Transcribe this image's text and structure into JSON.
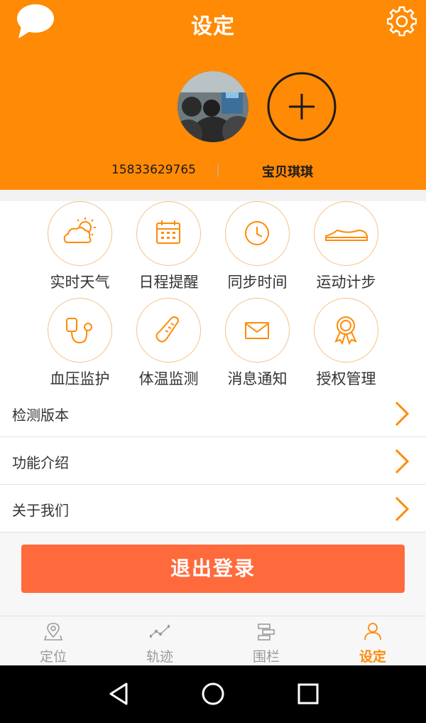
{
  "header": {
    "title": "设定",
    "chat_icon": "chat-bubble-icon",
    "settings_icon": "gear-icon",
    "account_phone": "15833629765",
    "child_name": "宝贝琪琪",
    "colors": {
      "primary": "#ff8a05"
    }
  },
  "functions": [
    {
      "label": "实时天气",
      "icon": "weather-icon"
    },
    {
      "label": "日程提醒",
      "icon": "calendar-icon"
    },
    {
      "label": "同步时间",
      "icon": "clock-icon"
    },
    {
      "label": "运动计步",
      "icon": "shoe-icon"
    },
    {
      "label": "血压监护",
      "icon": "stethoscope-icon"
    },
    {
      "label": "体温监测",
      "icon": "thermometer-icon"
    },
    {
      "label": "消息通知",
      "icon": "envelope-icon"
    },
    {
      "label": "授权管理",
      "icon": "award-icon"
    }
  ],
  "menu": [
    {
      "label": "检测版本"
    },
    {
      "label": "功能介绍"
    },
    {
      "label": "关于我们"
    }
  ],
  "logout": {
    "label": "退出登录",
    "color": "#ff6a3c"
  },
  "tabs": [
    {
      "label": "定位",
      "icon": "location-pin-icon",
      "active": false
    },
    {
      "label": "轨迹",
      "icon": "track-line-icon",
      "active": false
    },
    {
      "label": "围栏",
      "icon": "fence-icon",
      "active": false
    },
    {
      "label": "设定",
      "icon": "user-icon",
      "active": true
    }
  ]
}
